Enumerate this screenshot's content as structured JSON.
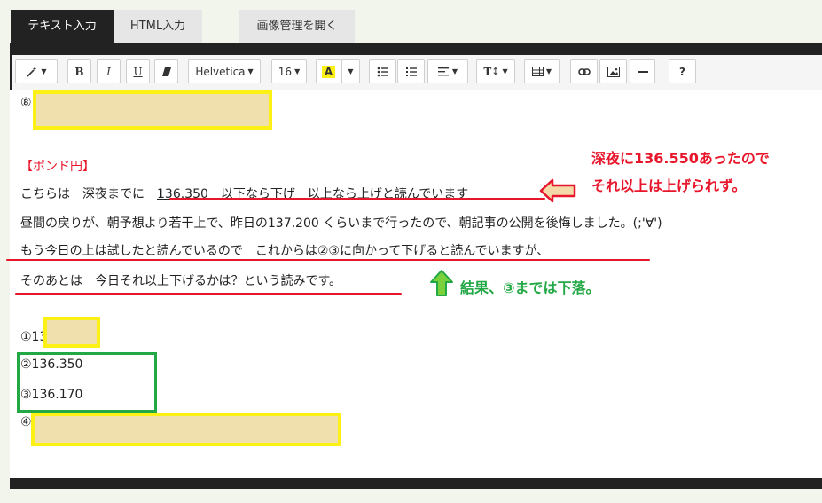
{
  "tabs": {
    "text_input": "テキスト入力",
    "html_input": "HTML入力",
    "image_manager": "画像管理を開く"
  },
  "toolbar": {
    "font_family": "Helvetica",
    "font_size": "16",
    "bold": "B",
    "italic": "I",
    "underline": "U",
    "text_style": "T",
    "help": "?"
  },
  "content": {
    "item8_marker": "⑧",
    "section_title": "【ポンド円】",
    "line1_prefix": "こちらは　深夜までに　",
    "line1_value": "136.350",
    "line1_suffix": "　以下なら下げ　以上なら上げと読んでいます",
    "line2": "昼間の戻りが、朝予想より若干上で、昨日の137.200 くらいまで行ったので、朝記事の公開を後悔しました。(;'∀')",
    "line3": "もう今日の上は試したと読んでいるので　これからは②③に向かって下げると読んでいますが、",
    "line4": "そのあとは　今日それ以上下げるかは？という読みです。",
    "item1": "①13",
    "item2": "②136.350",
    "item3": "③136.170",
    "item4_marker": "④"
  },
  "annotations": {
    "red_note_line1": "深夜に136.550あったので",
    "red_note_line2": "それ以上は上げられず。",
    "green_note": "結果、③までは下落。"
  },
  "colors": {
    "annotation_red": "#e8162b",
    "annotation_green": "#22a845",
    "highlight_yellow": "#fdf014",
    "mask_fill": "#f0e0ae",
    "arrow_fill": "#f4d9a9"
  }
}
